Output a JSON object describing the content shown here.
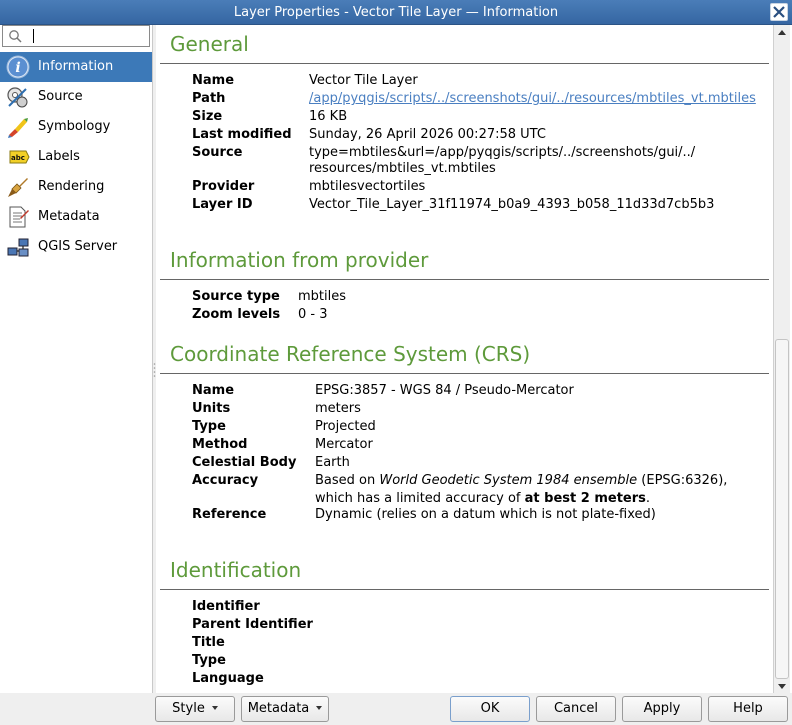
{
  "window": {
    "title": "Layer Properties - Vector Tile Layer — Information"
  },
  "search": {
    "value": "",
    "placeholder": ""
  },
  "sidebar": {
    "items": [
      {
        "label": "Information",
        "icon": "info-icon",
        "active": true
      },
      {
        "label": "Source",
        "icon": "source-icon",
        "active": false
      },
      {
        "label": "Symbology",
        "icon": "symbology-icon",
        "active": false
      },
      {
        "label": "Labels",
        "icon": "labels-icon",
        "active": false
      },
      {
        "label": "Rendering",
        "icon": "rendering-icon",
        "active": false
      },
      {
        "label": "Metadata",
        "icon": "metadata-icon",
        "active": false
      },
      {
        "label": "QGIS Server",
        "icon": "qgis-server-icon",
        "active": false
      }
    ]
  },
  "general": {
    "title": "General",
    "name_label": "Name",
    "name_value": "Vector Tile Layer",
    "path_label": "Path",
    "path_value": "/app/pyqgis/scripts/../screenshots/gui/../resources/mbtiles_vt.mbtiles",
    "size_label": "Size",
    "size_value": "16 KB",
    "modified_label": "Last modified",
    "modified_value": "Sunday, 26 April 2026 00:27:58 UTC",
    "source_label": "Source",
    "source_value_line1": "type=mbtiles&url=/app/pyqgis/scripts/../screenshots/gui/../",
    "source_value_line2": "resources/mbtiles_vt.mbtiles",
    "provider_label": "Provider",
    "provider_value": "mbtilesvectortiles",
    "layerid_label": "Layer ID",
    "layerid_value": "Vector_Tile_Layer_31f11974_b0a9_4393_b058_11d33d7cb5b3"
  },
  "provider": {
    "title": "Information from provider",
    "source_type_label": "Source type",
    "source_type_value": "mbtiles",
    "zoom_label": "Zoom levels",
    "zoom_value": "0 - 3"
  },
  "crs": {
    "title": "Coordinate Reference System (CRS)",
    "name_label": "Name",
    "name_value": "EPSG:3857 - WGS 84 / Pseudo-Mercator",
    "units_label": "Units",
    "units_value": "meters",
    "type_label": "Type",
    "type_value": "Projected",
    "method_label": "Method",
    "method_value": "Mercator",
    "body_label": "Celestial Body",
    "body_value": "Earth",
    "accuracy_label": "Accuracy",
    "accuracy_pre": "Based on ",
    "accuracy_italic": "World Geodetic System 1984 ensemble",
    "accuracy_post": " (EPSG:6326),",
    "accuracy_line2_pre": "which has a limited accuracy of ",
    "accuracy_line2_bold": "at best 2 meters",
    "accuracy_line2_post": ".",
    "reference_label": "Reference",
    "reference_value": "Dynamic (relies on a datum which is not plate-fixed)"
  },
  "identification": {
    "title": "Identification",
    "identifier_label": "Identifier",
    "parent_label": "Parent Identifier",
    "title_label": "Title",
    "type_label": "Type",
    "language_label": "Language"
  },
  "buttons": {
    "style": "Style",
    "metadata": "Metadata",
    "ok": "OK",
    "cancel": "Cancel",
    "apply": "Apply",
    "help": "Help"
  },
  "colors": {
    "section_title": "#5e9a3b",
    "selection": "#3c79b8",
    "titlebar": "#3e72ad",
    "link": "#4a7fc1"
  }
}
